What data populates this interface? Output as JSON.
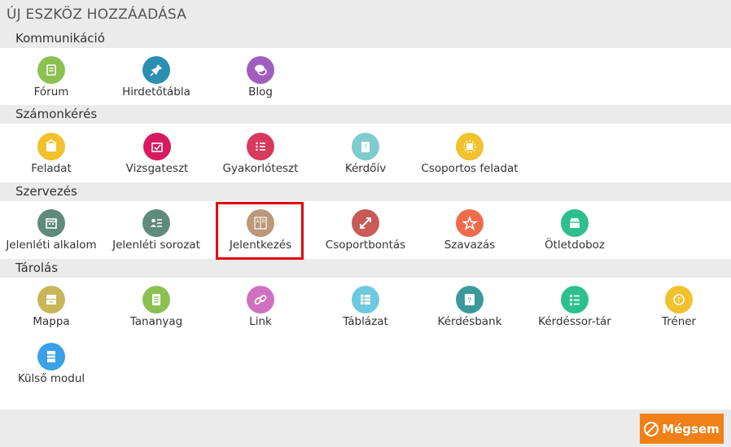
{
  "dialog": {
    "title": "ÚJ ESZKÖZ HOZZÁADÁSA",
    "cancel_label": "Mégsem"
  },
  "sections": [
    {
      "title": "Kommunikáció",
      "tools": [
        {
          "label": "Fórum",
          "icon": "forum-icon",
          "color": "#8cc152"
        },
        {
          "label": "Hirdetőtábla",
          "icon": "pin-icon",
          "color": "#2a8fb0"
        },
        {
          "label": "Blog",
          "icon": "chat-icon",
          "color": "#a05fbf"
        }
      ]
    },
    {
      "title": "Számonkérés",
      "tools": [
        {
          "label": "Feladat",
          "icon": "task-icon",
          "color": "#f2c12e"
        },
        {
          "label": "Vizsgateszt",
          "icon": "exam-icon",
          "color": "#d81b60"
        },
        {
          "label": "Gyakorlóteszt",
          "icon": "checklist-icon",
          "color": "#d63a5e"
        },
        {
          "label": "Kérdőív",
          "icon": "questionnaire-icon",
          "color": "#7fcccf"
        },
        {
          "label": "Csoportos feladat",
          "icon": "group-task-icon",
          "color": "#f2c12e"
        }
      ]
    },
    {
      "title": "Szervezés",
      "tools": [
        {
          "label": "Jelenléti alkalom",
          "icon": "calendar-icon",
          "color": "#5f8a7c"
        },
        {
          "label": "Jelenléti sorozat",
          "icon": "attendance-list-icon",
          "color": "#5f8a7c"
        },
        {
          "label": "Jelentkezés",
          "icon": "signup-icon",
          "color": "#b9997a"
        },
        {
          "label": "Csoportbontás",
          "icon": "split-icon",
          "color": "#c95a5a"
        },
        {
          "label": "Szavazás",
          "icon": "star-icon",
          "color": "#ef6b4e"
        },
        {
          "label": "Ötletdoboz",
          "icon": "inbox-icon",
          "color": "#2ebf8f"
        }
      ]
    },
    {
      "title": "Tárolás",
      "tools": [
        {
          "label": "Mappa",
          "icon": "folder-icon",
          "color": "#c9b55a"
        },
        {
          "label": "Tananyag",
          "icon": "document-icon",
          "color": "#8cc152"
        },
        {
          "label": "Link",
          "icon": "link-icon",
          "color": "#d070c0"
        },
        {
          "label": "Táblázat",
          "icon": "table-icon",
          "color": "#6ec8e0"
        },
        {
          "label": "Kérdésbank",
          "icon": "question-bank-icon",
          "color": "#3a9a9a"
        },
        {
          "label": "Kérdéssor-tár",
          "icon": "list-icon",
          "color": "#2ebf8f"
        },
        {
          "label": "Tréner",
          "icon": "trainer-icon",
          "color": "#f2c12e"
        },
        {
          "label": "Külső modul",
          "icon": "module-icon",
          "color": "#3aa0e8"
        }
      ]
    }
  ]
}
